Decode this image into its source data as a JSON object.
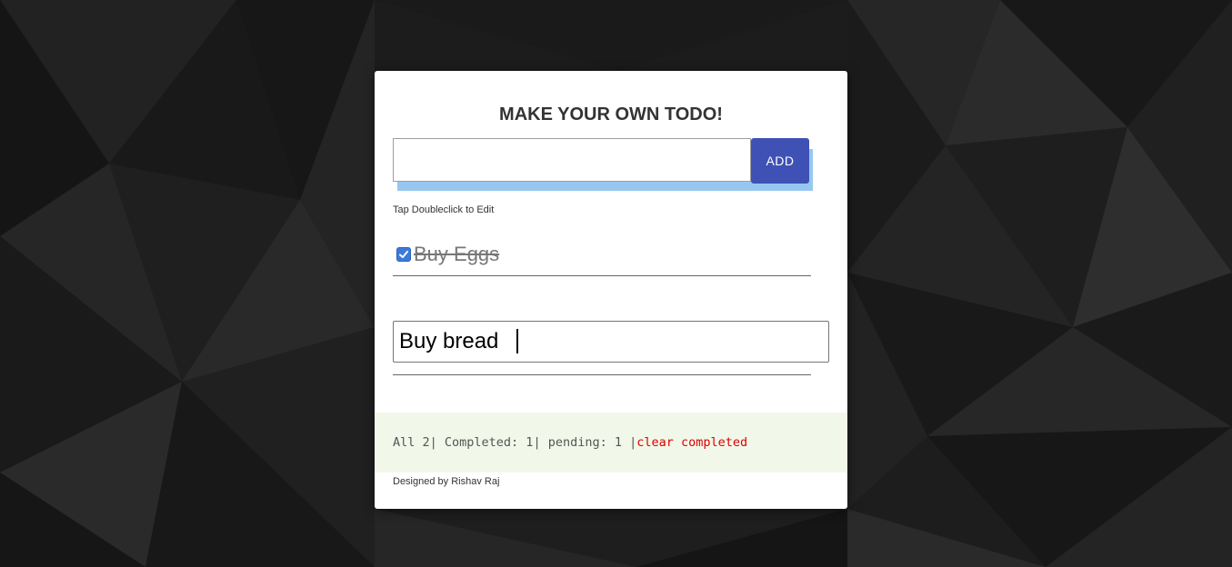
{
  "app": {
    "title": "MAKE YOUR OWN TODO!",
    "hint": "Tap Doubleclick to Edit",
    "credit": "Designed by Rishav Raj"
  },
  "new_todo": {
    "value": "",
    "add_label": "ADD"
  },
  "todos": [
    {
      "text": "Buy Eggs",
      "completed": true
    },
    {
      "text": "Buy bread",
      "completed": false,
      "editing": true
    }
  ],
  "stats": {
    "all_text": "All 2| ",
    "completed_text": "Completed: 1| ",
    "pending_text": "pending: 1 |",
    "clear_label": "clear completed"
  },
  "colors": {
    "accent": "#3f51b5",
    "stats_bg": "#f1f8e9",
    "clear_link": "#dd0000",
    "background": "#1a1a1a"
  }
}
